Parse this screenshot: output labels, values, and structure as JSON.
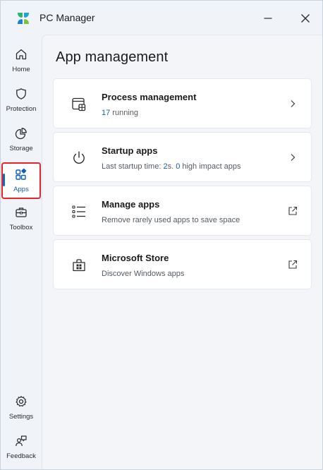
{
  "app": {
    "title": "PC Manager"
  },
  "sidebar": {
    "items": [
      {
        "label": "Home",
        "icon": "home-icon"
      },
      {
        "label": "Protection",
        "icon": "shield-icon"
      },
      {
        "label": "Storage",
        "icon": "pie-chart-icon"
      },
      {
        "label": "Apps",
        "icon": "apps-icon",
        "active": true
      },
      {
        "label": "Toolbox",
        "icon": "toolbox-icon"
      }
    ],
    "bottom": [
      {
        "label": "Settings",
        "icon": "gear-icon"
      },
      {
        "label": "Feedback",
        "icon": "feedback-icon"
      }
    ]
  },
  "main": {
    "title": "App management",
    "cards": [
      {
        "title": "Process management",
        "sub_count": "17",
        "sub_text": " running",
        "icon": "process-icon",
        "action": "chevron-right-icon"
      },
      {
        "title": "Startup apps",
        "sub_prefix": "Last startup time: ",
        "sub_time": "2",
        "sub_mid": "s. ",
        "sub_count": "0",
        "sub_suffix": " high impact apps",
        "icon": "power-icon",
        "action": "chevron-right-icon"
      },
      {
        "title": "Manage apps",
        "sub": "Remove rarely used apps to save space",
        "icon": "list-icon",
        "action": "external-link-icon"
      },
      {
        "title": "Microsoft Store",
        "sub": "Discover Windows apps",
        "icon": "store-icon",
        "action": "external-link-icon"
      }
    ]
  },
  "colors": {
    "accent": "#0f5fb8",
    "highlight_border": "#e8242a",
    "window_bg": "#f0f4f9",
    "card_bg": "#ffffff"
  }
}
